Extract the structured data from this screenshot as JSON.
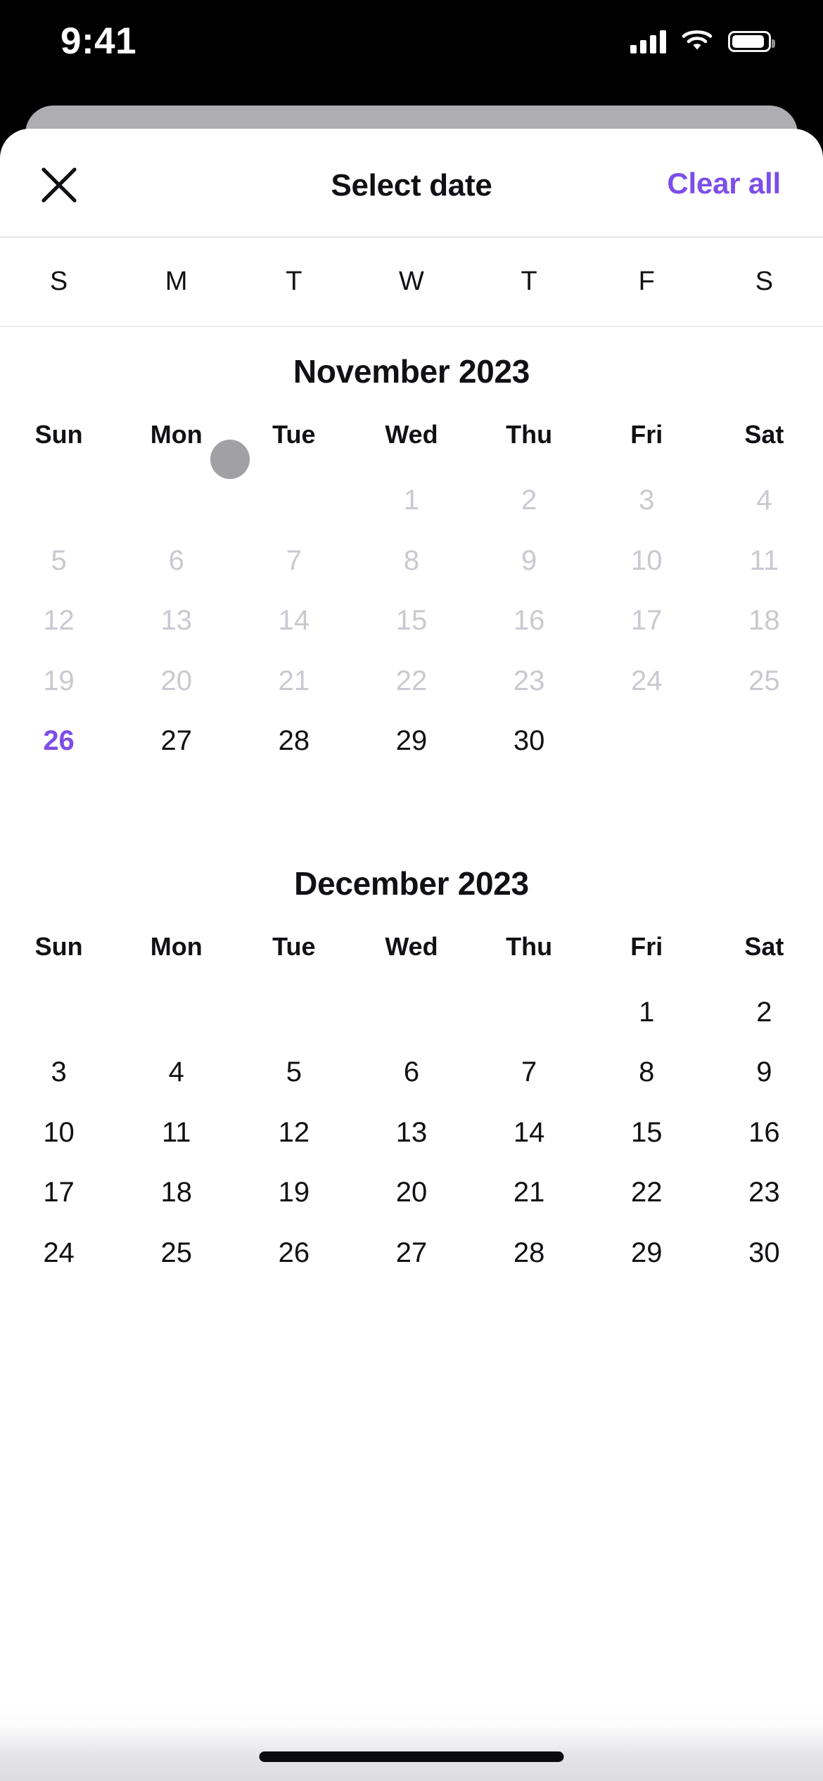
{
  "status_bar": {
    "time": "9:41",
    "icons": [
      "cellular-signal-icon",
      "wifi-icon",
      "battery-icon"
    ],
    "battery_level_pct": 82
  },
  "sheet": {
    "title": "Select date",
    "close_label": "✕",
    "clear_all_label": "Clear all",
    "accent_color": "#7D4EE8",
    "text_color": "#111014",
    "muted_color": "#C9C9D1"
  },
  "weekday_bar": {
    "letters": [
      "S",
      "M",
      "T",
      "W",
      "T",
      "F",
      "S"
    ],
    "scroll_dot": "scroll-position-dot"
  },
  "months": [
    {
      "title": "November 2023",
      "day_headers": [
        "Sun",
        "Mon",
        "Tue",
        "Wed",
        "Thu",
        "Fri",
        "Sat"
      ],
      "weeks": [
        [
          {
            "label": "",
            "state": "blank"
          },
          {
            "label": "",
            "state": "blank"
          },
          {
            "label": "",
            "state": "blank"
          },
          {
            "label": "1",
            "state": "disabled"
          },
          {
            "label": "2",
            "state": "disabled"
          },
          {
            "label": "3",
            "state": "disabled"
          },
          {
            "label": "4",
            "state": "disabled"
          }
        ],
        [
          {
            "label": "5",
            "state": "disabled"
          },
          {
            "label": "6",
            "state": "disabled"
          },
          {
            "label": "7",
            "state": "disabled"
          },
          {
            "label": "8",
            "state": "disabled"
          },
          {
            "label": "9",
            "state": "disabled"
          },
          {
            "label": "10",
            "state": "disabled"
          },
          {
            "label": "11",
            "state": "disabled"
          }
        ],
        [
          {
            "label": "12",
            "state": "disabled"
          },
          {
            "label": "13",
            "state": "disabled"
          },
          {
            "label": "14",
            "state": "disabled"
          },
          {
            "label": "15",
            "state": "disabled"
          },
          {
            "label": "16",
            "state": "disabled"
          },
          {
            "label": "17",
            "state": "disabled"
          },
          {
            "label": "18",
            "state": "disabled"
          }
        ],
        [
          {
            "label": "19",
            "state": "disabled"
          },
          {
            "label": "20",
            "state": "disabled"
          },
          {
            "label": "21",
            "state": "disabled"
          },
          {
            "label": "22",
            "state": "disabled"
          },
          {
            "label": "23",
            "state": "disabled"
          },
          {
            "label": "24",
            "state": "disabled"
          },
          {
            "label": "25",
            "state": "disabled"
          }
        ],
        [
          {
            "label": "26",
            "state": "today"
          },
          {
            "label": "27",
            "state": "enabled"
          },
          {
            "label": "28",
            "state": "enabled"
          },
          {
            "label": "29",
            "state": "enabled"
          },
          {
            "label": "30",
            "state": "enabled"
          },
          {
            "label": "",
            "state": "blank"
          },
          {
            "label": "",
            "state": "blank"
          }
        ]
      ]
    },
    {
      "title": "December 2023",
      "day_headers": [
        "Sun",
        "Mon",
        "Tue",
        "Wed",
        "Thu",
        "Fri",
        "Sat"
      ],
      "weeks": [
        [
          {
            "label": "",
            "state": "blank"
          },
          {
            "label": "",
            "state": "blank"
          },
          {
            "label": "",
            "state": "blank"
          },
          {
            "label": "",
            "state": "blank"
          },
          {
            "label": "",
            "state": "blank"
          },
          {
            "label": "1",
            "state": "enabled"
          },
          {
            "label": "2",
            "state": "enabled"
          }
        ],
        [
          {
            "label": "3",
            "state": "enabled"
          },
          {
            "label": "4",
            "state": "enabled"
          },
          {
            "label": "5",
            "state": "enabled"
          },
          {
            "label": "6",
            "state": "enabled"
          },
          {
            "label": "7",
            "state": "enabled"
          },
          {
            "label": "8",
            "state": "enabled"
          },
          {
            "label": "9",
            "state": "enabled"
          }
        ],
        [
          {
            "label": "10",
            "state": "enabled"
          },
          {
            "label": "11",
            "state": "enabled"
          },
          {
            "label": "12",
            "state": "enabled"
          },
          {
            "label": "13",
            "state": "enabled"
          },
          {
            "label": "14",
            "state": "enabled"
          },
          {
            "label": "15",
            "state": "enabled"
          },
          {
            "label": "16",
            "state": "enabled"
          }
        ],
        [
          {
            "label": "17",
            "state": "enabled"
          },
          {
            "label": "18",
            "state": "enabled"
          },
          {
            "label": "19",
            "state": "enabled"
          },
          {
            "label": "20",
            "state": "enabled"
          },
          {
            "label": "21",
            "state": "enabled"
          },
          {
            "label": "22",
            "state": "enabled"
          },
          {
            "label": "23",
            "state": "enabled"
          }
        ],
        [
          {
            "label": "24",
            "state": "enabled"
          },
          {
            "label": "25",
            "state": "enabled"
          },
          {
            "label": "26",
            "state": "enabled"
          },
          {
            "label": "27",
            "state": "enabled"
          },
          {
            "label": "28",
            "state": "enabled"
          },
          {
            "label": "29",
            "state": "enabled"
          },
          {
            "label": "30",
            "state": "enabled"
          }
        ]
      ]
    }
  ],
  "home_indicator": "home-indicator-bar"
}
